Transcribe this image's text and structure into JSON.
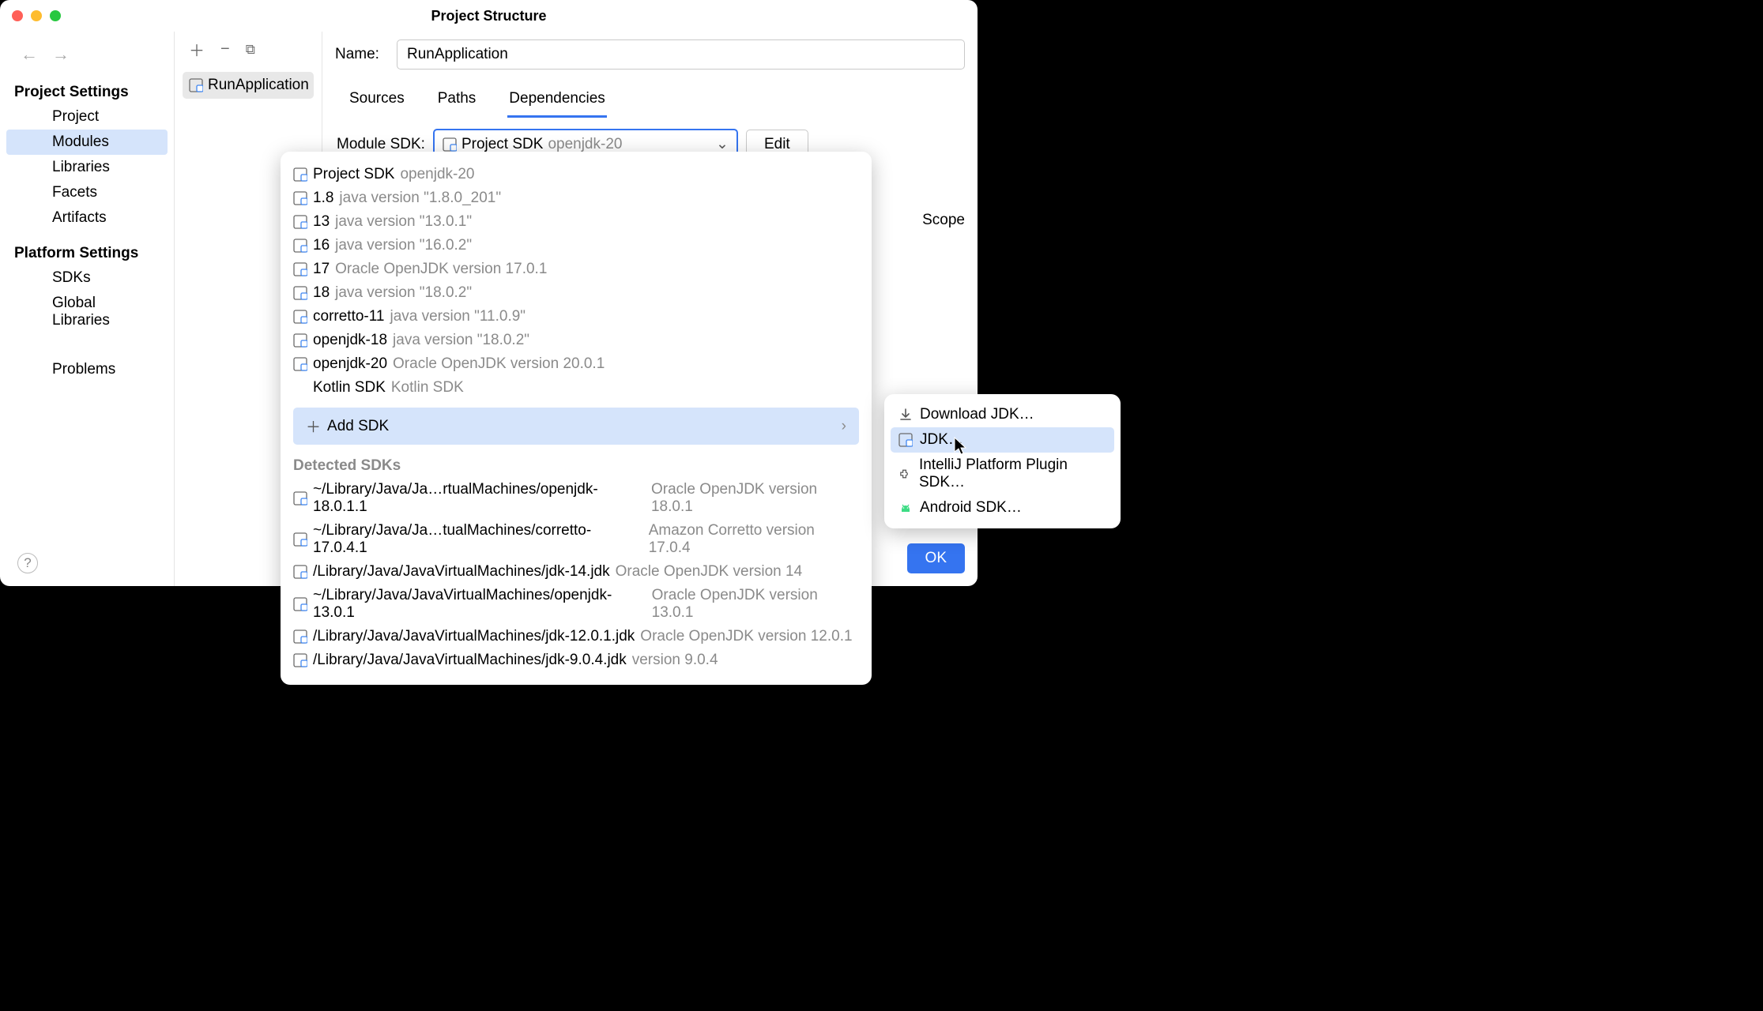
{
  "window_title": "Project Structure",
  "sidebar": {
    "section1_title": "Project Settings",
    "items1": [
      "Project",
      "Modules",
      "Libraries",
      "Facets",
      "Artifacts"
    ],
    "section2_title": "Platform Settings",
    "items2": [
      "SDKs",
      "Global Libraries"
    ],
    "section3_items": [
      "Problems"
    ],
    "selected": "Modules"
  },
  "module_list": {
    "items": [
      "RunApplication"
    ]
  },
  "main": {
    "name_label": "Name:",
    "name_value": "RunApplication",
    "tabs": [
      "Sources",
      "Paths",
      "Dependencies"
    ],
    "active_tab": "Dependencies",
    "sdk_label": "Module SDK:",
    "sdk_selected_primary": "Project SDK",
    "sdk_selected_secondary": "openjdk-20",
    "edit_button": "Edit",
    "scope_header": "Scope",
    "ok_button": "OK"
  },
  "sdk_popup": {
    "sdks": [
      {
        "name": "Project SDK",
        "detail": "openjdk-20",
        "icon": "sdk"
      },
      {
        "name": "1.8",
        "detail": "java version \"1.8.0_201\"",
        "icon": "sdk"
      },
      {
        "name": "13",
        "detail": "java version \"13.0.1\"",
        "icon": "sdk"
      },
      {
        "name": "16",
        "detail": "java version \"16.0.2\"",
        "icon": "sdk"
      },
      {
        "name": "17",
        "detail": "Oracle OpenJDK version 17.0.1",
        "icon": "sdk"
      },
      {
        "name": "18",
        "detail": "java version \"18.0.2\"",
        "icon": "sdk"
      },
      {
        "name": "corretto-11",
        "detail": "java version \"11.0.9\"",
        "icon": "sdk"
      },
      {
        "name": "openjdk-18",
        "detail": "java version \"18.0.2\"",
        "icon": "sdk"
      },
      {
        "name": "openjdk-20",
        "detail": "Oracle OpenJDK version 20.0.1",
        "icon": "sdk"
      },
      {
        "name": "Kotlin SDK",
        "detail": "Kotlin SDK",
        "icon": "kotlin"
      }
    ],
    "add_sdk_label": "Add SDK",
    "detected_label": "Detected SDKs",
    "detected": [
      {
        "path": "~/Library/Java/Ja…rtualMachines/openjdk-18.0.1.1",
        "detail": "Oracle OpenJDK version 18.0.1"
      },
      {
        "path": "~/Library/Java/Ja…tualMachines/corretto-17.0.4.1",
        "detail": "Amazon Corretto version 17.0.4"
      },
      {
        "path": "/Library/Java/JavaVirtualMachines/jdk-14.jdk",
        "detail": "Oracle OpenJDK version 14"
      },
      {
        "path": "~/Library/Java/JavaVirtualMachines/openjdk-13.0.1",
        "detail": "Oracle OpenJDK version 13.0.1"
      },
      {
        "path": "/Library/Java/JavaVirtualMachines/jdk-12.0.1.jdk",
        "detail": "Oracle OpenJDK version 12.0.1"
      },
      {
        "path": "/Library/Java/JavaVirtualMachines/jdk-9.0.4.jdk",
        "detail": "version 9.0.4"
      }
    ]
  },
  "submenu": {
    "items": [
      {
        "label": "Download JDK…",
        "icon": "download"
      },
      {
        "label": "JDK…",
        "icon": "sdk",
        "hover": true
      },
      {
        "label": "IntelliJ Platform Plugin SDK…",
        "icon": "plugin"
      },
      {
        "label": "Android SDK…",
        "icon": "android"
      }
    ]
  }
}
